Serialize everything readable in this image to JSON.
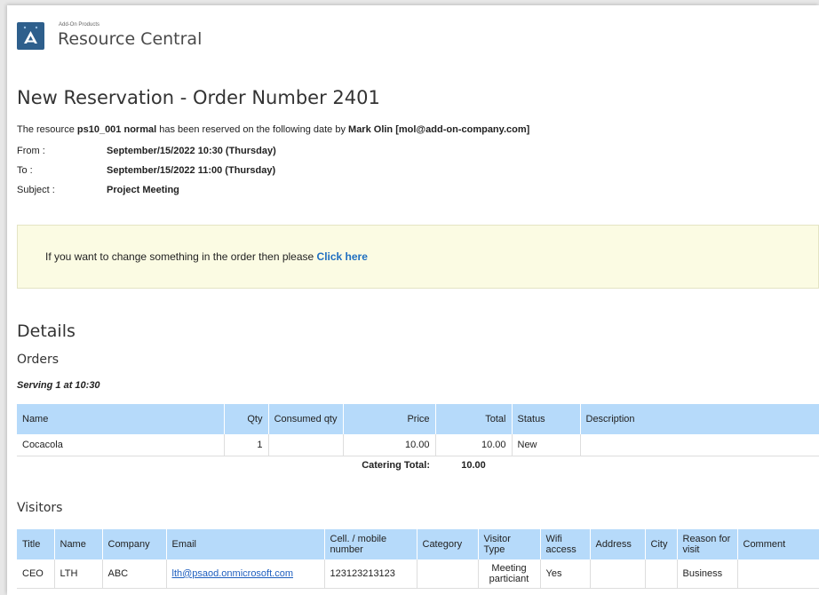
{
  "brand": {
    "small": "Add-On Products",
    "name": "Resource Central"
  },
  "title": "New Reservation - Order Number 2401",
  "intro": {
    "prefix": "The resource ",
    "resource": "ps10_001 normal",
    "middle": " has been reserved on the following date by ",
    "person": "Mark Olin [mol@add-on-company.com]"
  },
  "meta": {
    "from_label": "From :",
    "from_value": "September/15/2022 10:30 (Thursday)",
    "to_label": "To :",
    "to_value": "September/15/2022 11:00 (Thursday)",
    "subject_label": "Subject :",
    "subject_value": "Project Meeting"
  },
  "notice": {
    "text": "If you want to change something in the order then please ",
    "link": "Click here"
  },
  "details_title": "Details",
  "orders": {
    "title": "Orders",
    "serving": "Serving 1 at 10:30",
    "columns": [
      "Name",
      "Qty",
      "Consumed qty",
      "Price",
      "Total",
      "Status",
      "Description"
    ],
    "rows": [
      {
        "name": "Cocacola",
        "qty": "1",
        "consumed": "",
        "price": "10.00",
        "total": "10.00",
        "status": "New",
        "description": ""
      }
    ],
    "total_label": "Catering Total:",
    "total_value": "10.00"
  },
  "visitors": {
    "title": "Visitors",
    "columns": [
      "Title",
      "Name",
      "Company",
      "Email",
      "Cell. / mobile number",
      "Category",
      "Visitor Type",
      "Wifi access",
      "Address",
      "City",
      "Reason for visit",
      "Comment"
    ],
    "rows": [
      {
        "title": "CEO",
        "name": "LTH",
        "company": "ABC",
        "email": "lth@psaod.onmicrosoft.com",
        "phone": "123123213123",
        "category": "",
        "visitor_type": "Meeting particiant",
        "wifi": "Yes",
        "address": "",
        "city": "",
        "reason": "Business",
        "comment": ""
      }
    ]
  },
  "colors": {
    "header_bg": "#b6dafa",
    "notice_bg": "#fbfbe3",
    "link": "#1f6fc1",
    "logo": "#2e5f8c"
  }
}
